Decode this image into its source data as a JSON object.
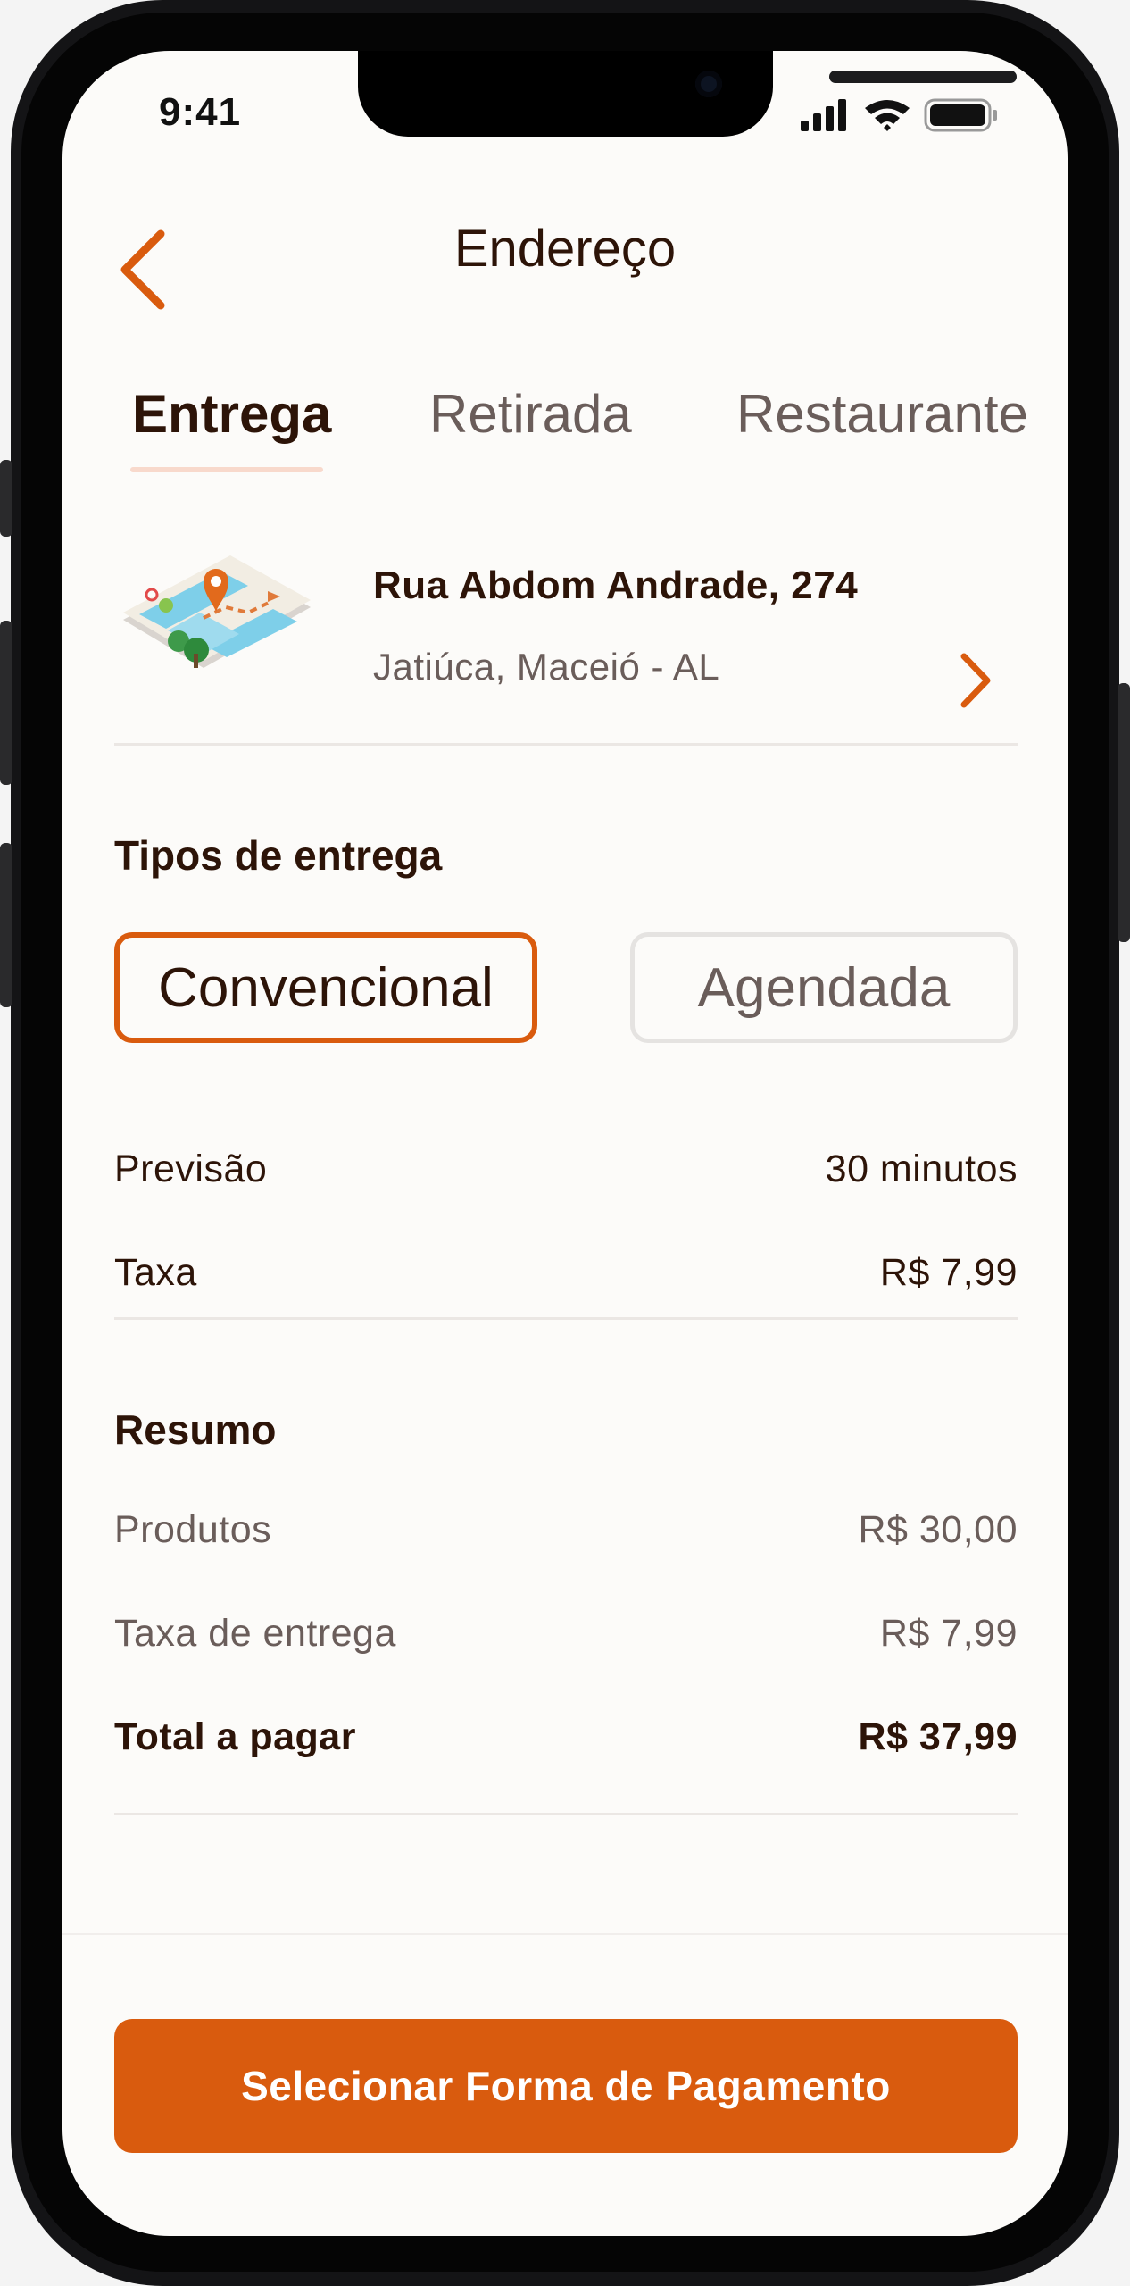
{
  "status_bar": {
    "time": "9:41"
  },
  "header": {
    "title": "Endereço"
  },
  "tabs": [
    {
      "label": "Entrega",
      "active": true
    },
    {
      "label": "Retirada",
      "active": false
    },
    {
      "label": "Restaurante",
      "active": false
    }
  ],
  "address": {
    "street": "Rua Abdom Andrade, 274",
    "city": "Jatiúca, Maceió - AL"
  },
  "delivery_types": {
    "title": "Tipos de entrega",
    "options": [
      {
        "label": "Convencional",
        "selected": true
      },
      {
        "label": "Agendada",
        "selected": false
      }
    ],
    "forecast_label": "Previsão",
    "forecast_value": "30 minutos",
    "fee_label": "Taxa",
    "fee_value": "R$ 7,99"
  },
  "summary": {
    "title": "Resumo",
    "products_label": "Produtos",
    "products_value": "R$ 30,00",
    "delivery_fee_label": "Taxa de entrega",
    "delivery_fee_value": "R$ 7,99",
    "total_label": "Total a pagar",
    "total_value": "R$ 37,99"
  },
  "footer": {
    "button_label": "Selecionar Forma de Pagamento"
  },
  "colors": {
    "accent": "#d95b0e",
    "text_dark": "#2d1408",
    "text_muted": "#6a5d5a",
    "background": "#fcfbf9",
    "tab_underline": "#f8d9cc"
  },
  "icons": [
    "back-chevron-icon",
    "signal-icon",
    "wifi-icon",
    "battery-icon",
    "map-location-icon",
    "chevron-right-icon"
  ]
}
